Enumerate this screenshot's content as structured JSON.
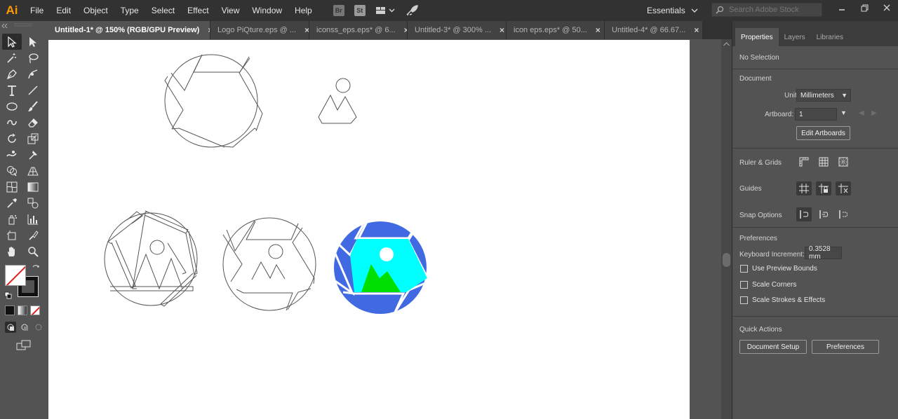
{
  "app": {
    "logo": "Ai"
  },
  "menu": [
    "File",
    "Edit",
    "Object",
    "Type",
    "Select",
    "Effect",
    "View",
    "Window",
    "Help"
  ],
  "toolbar_icons": {
    "br": "Br",
    "st": "St"
  },
  "workspace": {
    "label": "Essentials"
  },
  "search": {
    "placeholder": "Search Adobe Stock"
  },
  "tabs": [
    {
      "label": "Untitled-1* @ 150% (RGB/GPU Preview)"
    },
    {
      "label": "Logo PiQture.eps @ ..."
    },
    {
      "label": "iconss_eps.eps* @ 6..."
    },
    {
      "label": "Untitled-3* @ 300% ..."
    },
    {
      "label": "icon eps.eps* @ 50..."
    },
    {
      "label": "Untitled-4* @ 66.67..."
    }
  ],
  "panel": {
    "tabs": [
      "Properties",
      "Layers",
      "Libraries"
    ],
    "no_selection": "No Selection",
    "document": {
      "heading": "Document",
      "units_label": "Units:",
      "units_value": "Millimeters",
      "artboard_label": "Artboard:",
      "artboard_value": "1",
      "edit_artboards": "Edit Artboards"
    },
    "ruler_grids": "Ruler & Grids",
    "guides": "Guides",
    "snap_options": "Snap Options",
    "preferences": {
      "heading": "Preferences",
      "keyboard_increment_label": "Keyboard Increment:",
      "keyboard_increment_value": "0.3528 mm",
      "checkboxes": [
        "Use Preview Bounds",
        "Scale Corners",
        "Scale Strokes & Effects"
      ]
    },
    "quick_actions": {
      "heading": "Quick Actions",
      "document_setup": "Document Setup",
      "preferences": "Preferences"
    }
  },
  "colors": {
    "logo_blue": "#4169e1",
    "logo_cyan": "#00ffff",
    "logo_green": "#00e000",
    "ai_orange": "#ff9a00"
  }
}
